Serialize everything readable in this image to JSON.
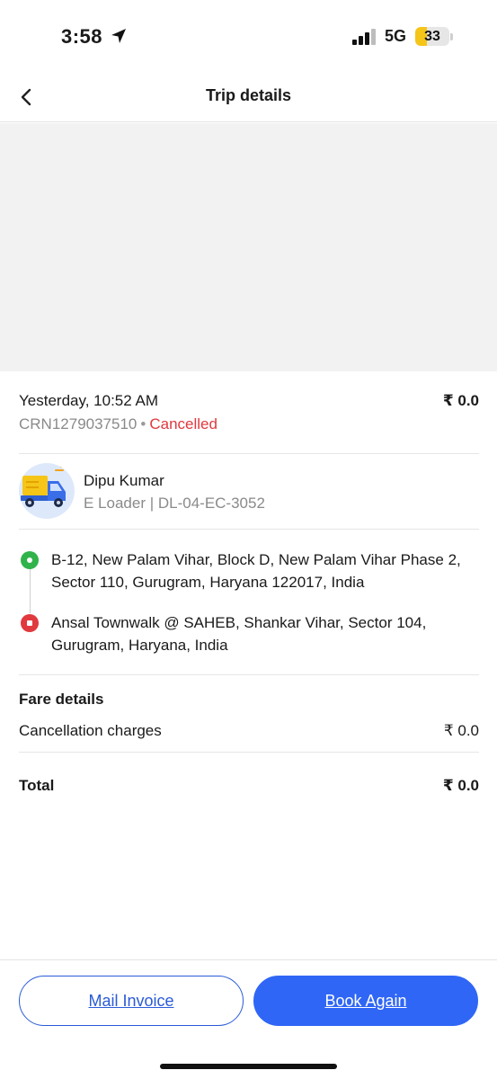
{
  "status_bar": {
    "time": "3:58",
    "network": "5G",
    "battery": "33",
    "battery_level_percent": 33,
    "icons": [
      "location-arrow-icon",
      "cellular-signal-icon",
      "battery-icon"
    ]
  },
  "header": {
    "title": "Trip details",
    "back_icon": "chevron-left-icon"
  },
  "trip": {
    "date_time": "Yesterday, 10:52 AM",
    "fare": "₹ 0.0",
    "crn": "CRN1279037510",
    "separator": "•",
    "status": "Cancelled"
  },
  "driver": {
    "name": "Dipu Kumar",
    "vehicle": "E Loader | DL-04-EC-3052",
    "vehicle_icon": "e-loader-truck-icon"
  },
  "route": {
    "pickup": "B-12,  New Palam Vihar,  Block D,  New Palam Vihar Phase 2,  Sector 110,  Gurugram,  Haryana 122017,  India",
    "drop": "Ansal Townwalk @ SAHEB, Shankar Vihar, Sector 104, Gurugram, Haryana, India"
  },
  "fare_details": {
    "heading": "Fare details",
    "items": [
      {
        "label": "Cancellation charges",
        "value": "₹ 0.0"
      }
    ],
    "total_label": "Total",
    "total_value": "₹ 0.0"
  },
  "actions": {
    "mail_invoice": "Mail Invoice",
    "book_again": "Book Again"
  },
  "colors": {
    "accent": "#2f66f6",
    "cancelled": "#e0393e",
    "pickup": "#2fb34a",
    "drop": "#e0393e",
    "battery": "#f5c518"
  }
}
